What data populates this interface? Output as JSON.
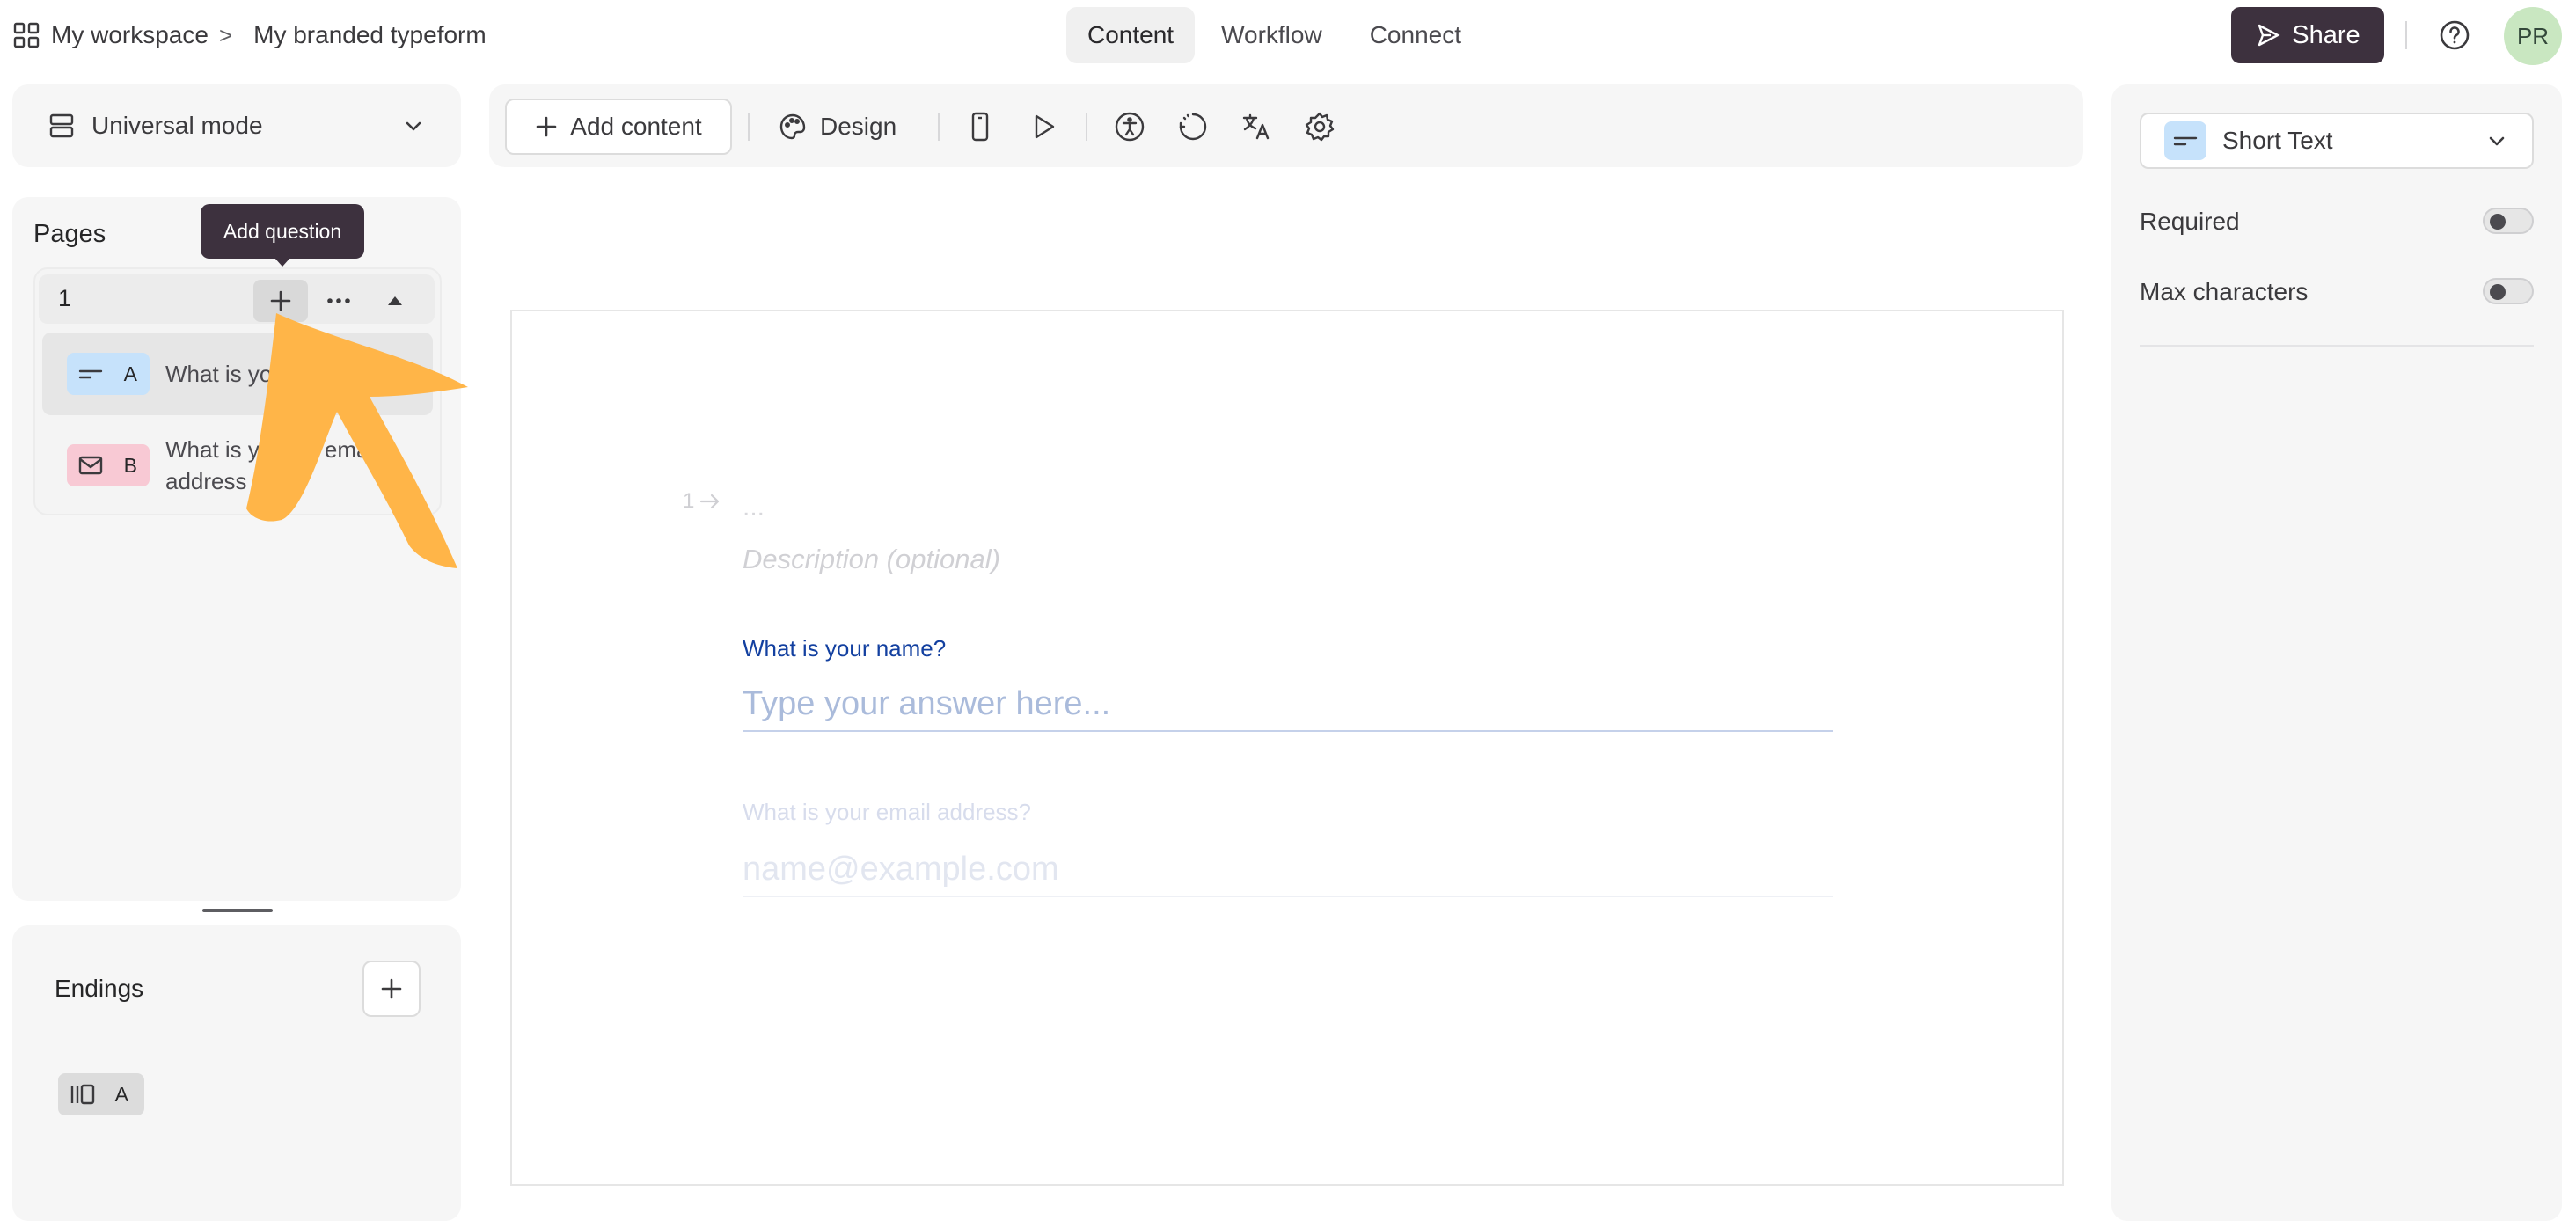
{
  "header": {
    "breadcrumbs": [
      "My workspace",
      "My branded typeform"
    ],
    "separator": ">",
    "tabs": [
      {
        "label": "Content",
        "active": true
      },
      {
        "label": "Workflow",
        "active": false
      },
      {
        "label": "Connect",
        "active": false
      }
    ],
    "share_label": "Share",
    "avatar_initials": "PR"
  },
  "sidebar": {
    "mode_label": "Universal mode",
    "pages_title": "Pages",
    "tooltip": "Add question",
    "page_number": "1",
    "questions": [
      {
        "letter": "A",
        "text": "What is your name?",
        "visible_text": "What is yo",
        "type": "short-text",
        "color": "#c6e2fb",
        "selected": true
      },
      {
        "letter": "B",
        "text": "What is your email address?",
        "visible_text_line1": "What is y",
        "visible_text_line1b": "ema",
        "visible_text_line2": "address",
        "type": "email",
        "color": "#f8c9d4",
        "selected": false
      }
    ],
    "endings_title": "Endings",
    "ending_letter": "A"
  },
  "toolbar": {
    "add_content_label": "Add content",
    "design_label": "Design",
    "icons": [
      "mobile-preview-icon",
      "play-icon",
      "accessibility-icon",
      "loading-icon",
      "translate-icon",
      "settings-icon"
    ]
  },
  "canvas": {
    "question_number": "1",
    "question_title": "...",
    "description_placeholder": "Description (optional)",
    "field1_label": "What is your name?",
    "field1_placeholder": "Type your answer here...",
    "field2_label": "What is your email address?",
    "field2_placeholder": "name@example.com"
  },
  "right_panel": {
    "type_label": "Short Text",
    "options": [
      {
        "label": "Required",
        "enabled": false
      },
      {
        "label": "Max characters",
        "enabled": false
      }
    ]
  },
  "colors": {
    "accent_dark": "#3d313e",
    "annotation_arrow": "#ffb548",
    "link_blue": "#1340a0",
    "avatar_bg": "#c9e7c1"
  }
}
